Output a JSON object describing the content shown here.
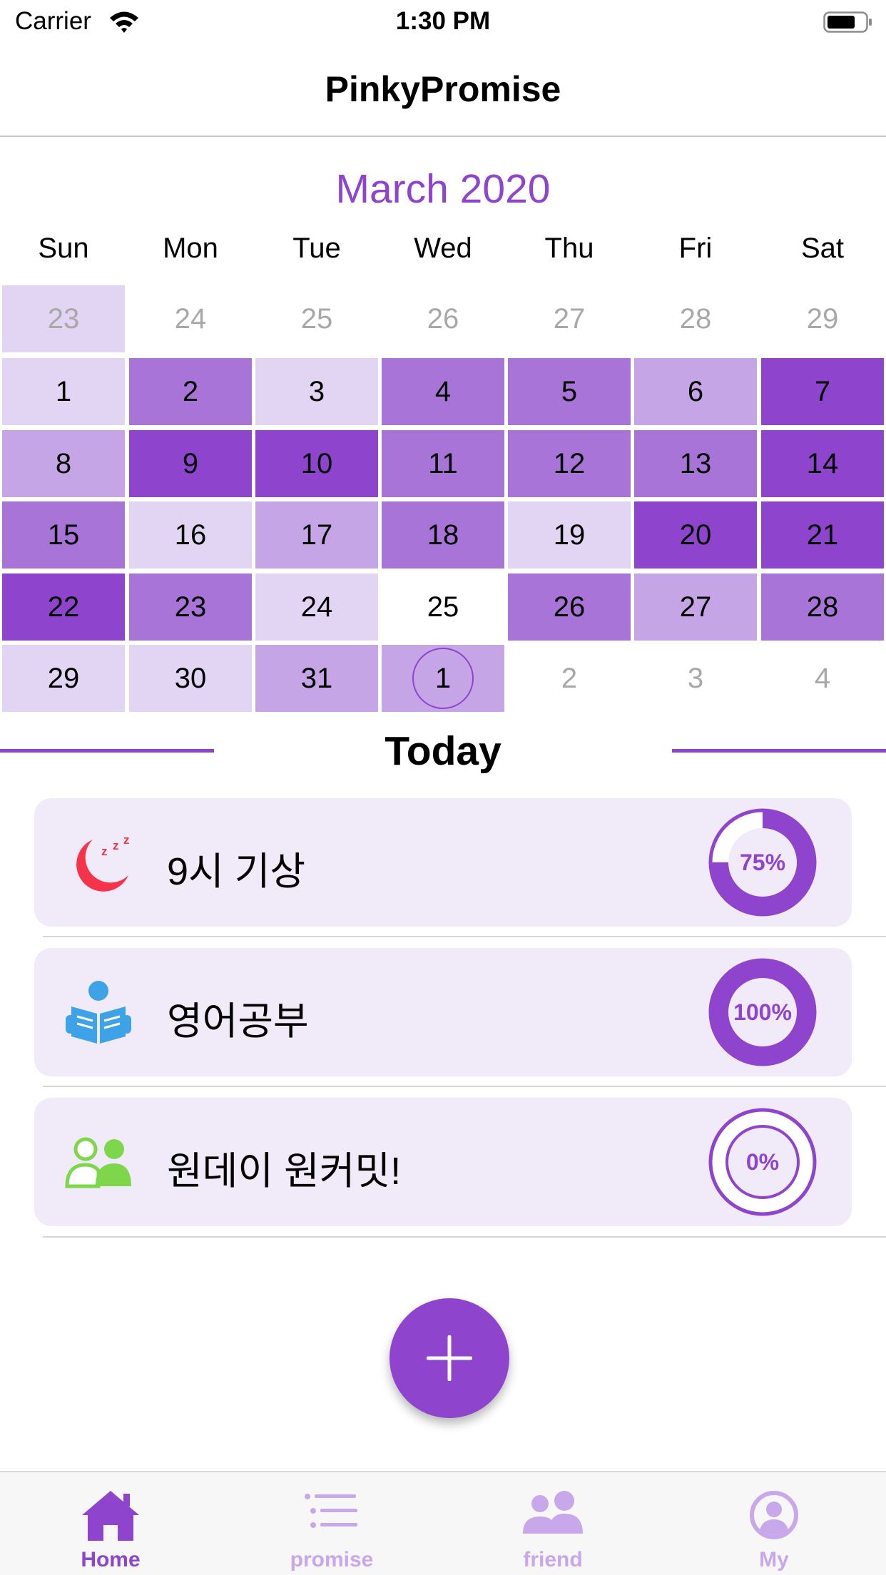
{
  "status_bar": {
    "carrier": "Carrier",
    "time": "1:30 PM"
  },
  "nav": {
    "title": "PinkyPromise"
  },
  "calendar": {
    "month_title": "March 2020",
    "weekdays": [
      "Sun",
      "Mon",
      "Tue",
      "Wed",
      "Thu",
      "Fri",
      "Sat"
    ],
    "weeks": [
      [
        {
          "day": "23",
          "level": 1,
          "outside": true
        },
        {
          "day": "24",
          "level": 0,
          "outside": true
        },
        {
          "day": "25",
          "level": 0,
          "outside": true
        },
        {
          "day": "26",
          "level": 0,
          "outside": true
        },
        {
          "day": "27",
          "level": 0,
          "outside": true
        },
        {
          "day": "28",
          "level": 0,
          "outside": true
        },
        {
          "day": "29",
          "level": 0,
          "outside": true
        }
      ],
      [
        {
          "day": "1",
          "level": 1
        },
        {
          "day": "2",
          "level": 3
        },
        {
          "day": "3",
          "level": 1
        },
        {
          "day": "4",
          "level": 3
        },
        {
          "day": "5",
          "level": 3
        },
        {
          "day": "6",
          "level": 2
        },
        {
          "day": "7",
          "level": 4
        }
      ],
      [
        {
          "day": "8",
          "level": 2
        },
        {
          "day": "9",
          "level": 4
        },
        {
          "day": "10",
          "level": 4
        },
        {
          "day": "11",
          "level": 3
        },
        {
          "day": "12",
          "level": 3
        },
        {
          "day": "13",
          "level": 3
        },
        {
          "day": "14",
          "level": 4
        }
      ],
      [
        {
          "day": "15",
          "level": 3
        },
        {
          "day": "16",
          "level": 1
        },
        {
          "day": "17",
          "level": 2
        },
        {
          "day": "18",
          "level": 3
        },
        {
          "day": "19",
          "level": 1
        },
        {
          "day": "20",
          "level": 4
        },
        {
          "day": "21",
          "level": 4
        }
      ],
      [
        {
          "day": "22",
          "level": 4
        },
        {
          "day": "23",
          "level": 3
        },
        {
          "day": "24",
          "level": 1
        },
        {
          "day": "25",
          "level": 0
        },
        {
          "day": "26",
          "level": 3
        },
        {
          "day": "27",
          "level": 2
        },
        {
          "day": "28",
          "level": 3
        }
      ],
      [
        {
          "day": "29",
          "level": 1
        },
        {
          "day": "30",
          "level": 1
        },
        {
          "day": "31",
          "level": 2
        },
        {
          "day": "1",
          "level": 2,
          "today": true
        },
        {
          "day": "2",
          "level": 0,
          "outside": true
        },
        {
          "day": "3",
          "level": 0,
          "outside": true
        },
        {
          "day": "4",
          "level": 0,
          "outside": true
        }
      ]
    ]
  },
  "today": {
    "title": "Today",
    "items": [
      {
        "label": "9시 기상",
        "progress_text": "75%",
        "progress": 0.75,
        "icon": "moon-sleep-icon"
      },
      {
        "label": "영어공부",
        "progress_text": "100%",
        "progress": 1.0,
        "icon": "reading-book-icon"
      },
      {
        "label": "원데이 원커밋!",
        "progress_text": "0%",
        "progress": 0.0,
        "icon": "friends-icon"
      }
    ]
  },
  "fab": {
    "icon": "plus-icon"
  },
  "tabs": [
    {
      "label": "Home",
      "icon": "home-icon",
      "active": true
    },
    {
      "label": "promise",
      "icon": "list-icon",
      "active": false
    },
    {
      "label": "friend",
      "icon": "people-icon",
      "active": false
    },
    {
      "label": "My",
      "icon": "profile-icon",
      "active": false
    }
  ],
  "colors": {
    "accent": "#8e44cc",
    "level_1": "#e2d4f3",
    "level_2": "#c5a5e5",
    "level_3": "#a874d8",
    "level_4": "#8e44cc",
    "card_bg": "#f1eaf9",
    "moon": "#f5334a",
    "book": "#3ea3e6",
    "friends": "#7ed64a",
    "tab_inactive": "#c8a8ea"
  }
}
